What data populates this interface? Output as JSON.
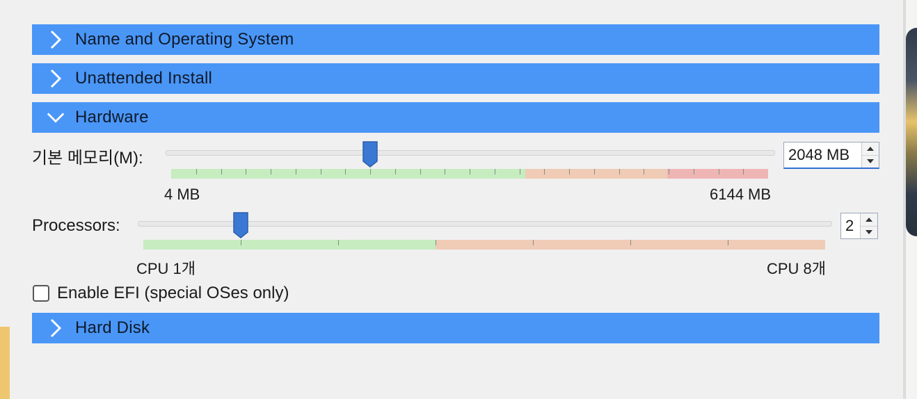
{
  "colors": {
    "header_bg": "#4a96f7",
    "slider_thumb": "#3a78d4",
    "range_ok": "#c6ecc0",
    "range_warn": "#f0cbb6",
    "range_bad": "#efb5b5"
  },
  "sections": {
    "name_os": {
      "title": "Name and Operating System",
      "icon": "chevron-right-icon",
      "expanded": false
    },
    "unattended": {
      "title": "Unattended Install",
      "icon": "chevron-right-icon",
      "expanded": false
    },
    "hardware": {
      "title": "Hardware",
      "icon": "chevron-down-icon",
      "expanded": true
    },
    "hard_disk": {
      "title": "Hard Disk",
      "icon": "chevron-right-icon",
      "expanded": false
    }
  },
  "memory": {
    "label": "기본 메모리(M):",
    "min_label": "4 MB",
    "max_label": "6144 MB",
    "min": 4,
    "max": 6144,
    "value": 2048,
    "spin_value": "2048 MB"
  },
  "processors": {
    "label": "Processors:",
    "min_label": "CPU 1개",
    "max_label": "CPU 8개",
    "min": 1,
    "max": 8,
    "value": 2,
    "spin_value": "2"
  },
  "efi": {
    "label": "Enable EFI (special OSes only)",
    "checked": false
  }
}
